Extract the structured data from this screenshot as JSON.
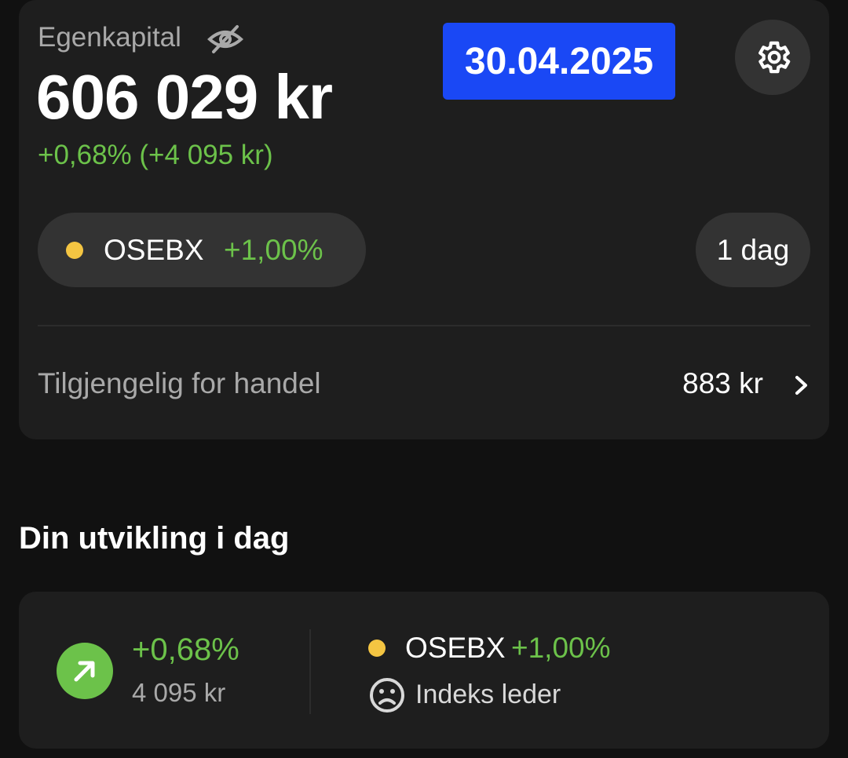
{
  "header": {
    "equity_label": "Egenkapital",
    "equity_value": "606 029 kr",
    "equity_change": "+0,68% (+4 095 kr)",
    "date": "30.04.2025"
  },
  "index_pill": {
    "name": "OSEBX",
    "change": "+1,00%"
  },
  "period": "1 dag",
  "available": {
    "label": "Tilgjengelig for handel",
    "value": "883 kr"
  },
  "today": {
    "title": "Din utvikling i dag",
    "my_change": "+0,68%",
    "my_amount": "4 095 kr",
    "index_name": "OSEBX",
    "index_change": "+1,00%",
    "status": "Indeks leder"
  },
  "colors": {
    "positive": "#6cc24a",
    "index_dot": "#f4c542",
    "date_badge": "#1a48f5"
  },
  "icons": [
    "eye-off-icon",
    "gear-icon",
    "chevron-right-icon",
    "arrow-up-right-icon",
    "sad-face-icon"
  ]
}
